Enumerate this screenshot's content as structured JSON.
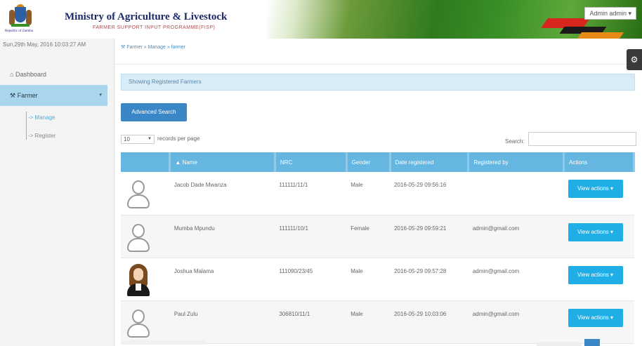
{
  "header": {
    "ministry_title": "Ministry of Agriculture & Livestock",
    "programme": "FARMER SUPPORT INPUT PROGRAMME(FISP)",
    "coat_caption": "Republic of Zambia",
    "user_menu": "Admin admin ▾"
  },
  "sidebar": {
    "date": "Sun,29th May, 2016 10:03:27 AM",
    "dashboard": "Dashboard",
    "farmer": "Farmer",
    "farmer_caret": "▾",
    "manage": "-> Manage",
    "register": "-> Register"
  },
  "breadcrumb": "Farmer » Manage » farmer",
  "panel_title": "Showing Registered Farmers",
  "advanced_search": "Advanced Search",
  "records": {
    "value": "10",
    "label": "records per page"
  },
  "search": {
    "label": "Search:",
    "placeholder": ""
  },
  "table": {
    "headers": [
      "",
      "Name",
      "NRC",
      "Gender",
      "Date registered",
      "Registered by",
      "Actions"
    ],
    "rows": [
      {
        "name": "Jacob Dade Mwanza",
        "nrc": "111111/11/1",
        "gender": "Male",
        "date": "2016-05-29 09:56:16",
        "by": "",
        "action": "View actions ▾",
        "avatar": "placeholder"
      },
      {
        "name": "Mumba Mpundu",
        "nrc": "111111/10/1",
        "gender": "Female",
        "date": "2016-05-29 09:59:21",
        "by": "admin@gmail.com",
        "action": "View actions ▾",
        "avatar": "placeholder"
      },
      {
        "name": "Joshua Malama",
        "nrc": "111090/23/45",
        "gender": "Male",
        "date": "2016-05-29 09:57:28",
        "by": "admin@gmail.com",
        "action": "View actions ▾",
        "avatar": "photo"
      },
      {
        "name": "Paul Zulu",
        "nrc": "306810/11/1",
        "gender": "Male",
        "date": "2016-05-29 10:03:06",
        "by": "admin@gmail.com",
        "action": "View actions ▾",
        "avatar": "placeholder"
      }
    ]
  },
  "colors": {
    "accent": "#65b6e1",
    "button": "#1faee6",
    "nav_active": "#a9d6ec"
  },
  "icons": {
    "dashboard": "dashboard-icon",
    "farmer": "wrench-icon",
    "settings": "gear-icon"
  }
}
